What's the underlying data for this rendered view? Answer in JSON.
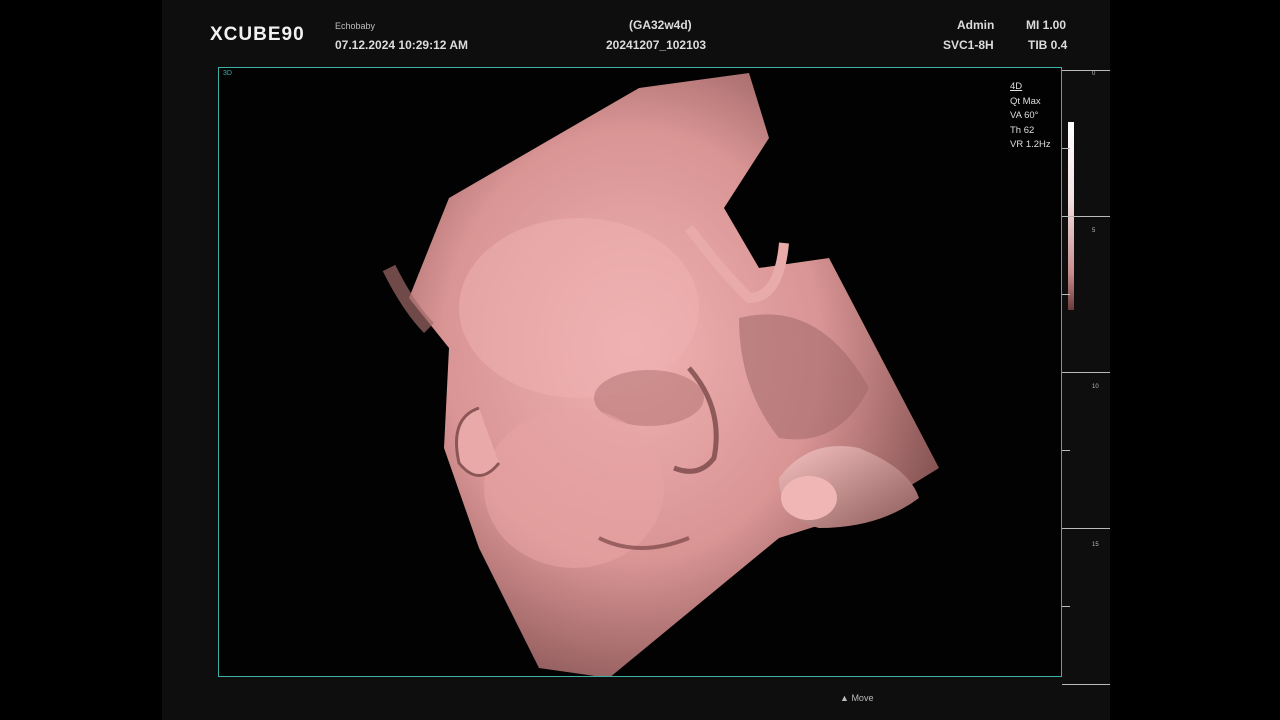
{
  "header": {
    "logo": "XCUBE90",
    "patient_name": "Echobaby",
    "datetime": "07.12.2024  10:29:12 AM",
    "gestational_age": "(GA32w4d)",
    "study_id": "20241207_102103",
    "operator": "Admin",
    "probe": "SVC1-8H",
    "mi": "MI 1.00",
    "tib": "TIB 0.4"
  },
  "viewport": {
    "corner_label": "3D",
    "image_description": "3D rendered fetal face",
    "render_color": "#e8a6a6",
    "border_color": "#3fb0a6"
  },
  "params": {
    "mode": "4D",
    "quality": "Qt Max",
    "view_angle": "VA 60°",
    "threshold": "Th 62",
    "volume_rate": "VR 1.2Hz"
  },
  "scale": {
    "labels": [
      "0",
      "5",
      "10",
      "15"
    ]
  },
  "footer": {
    "move_label": "Move",
    "move_icon": "move-icon"
  }
}
